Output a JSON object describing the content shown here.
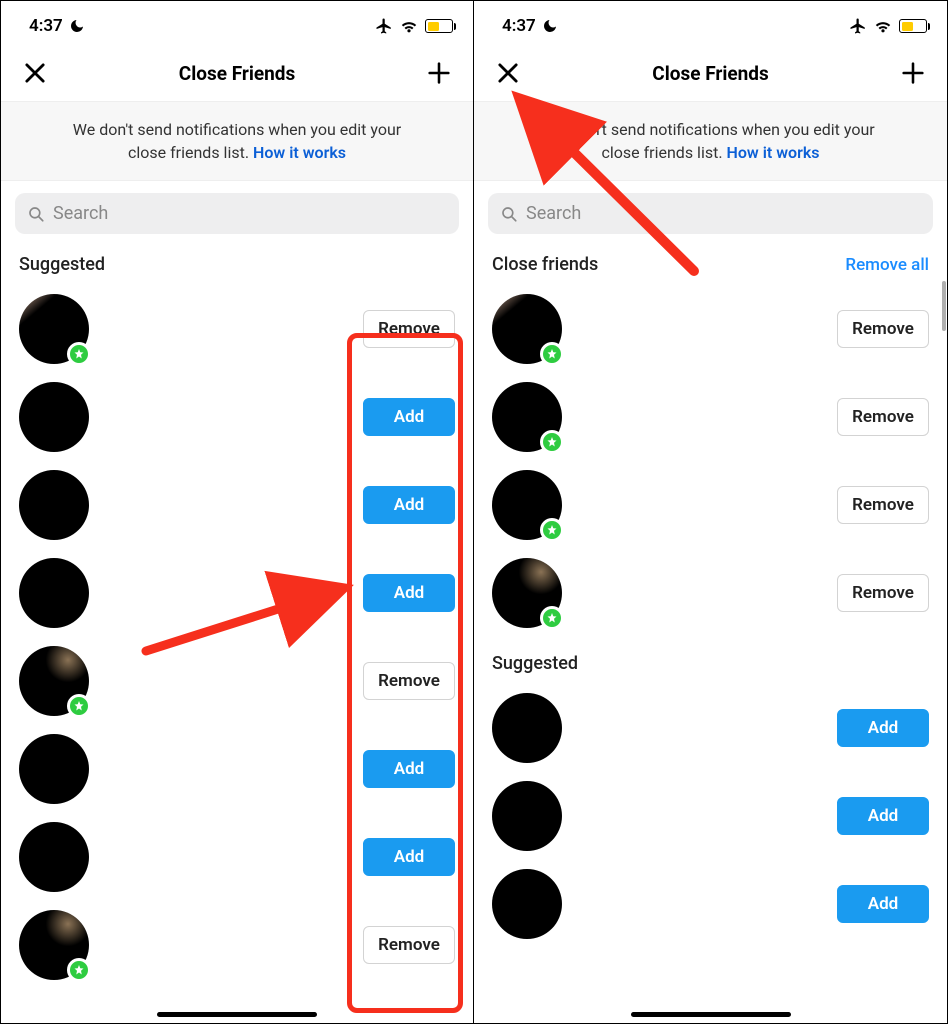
{
  "statusbar": {
    "time": "4:37"
  },
  "header": {
    "title": "Close Friends"
  },
  "banner": {
    "text_a": "We don't send notifications when you edit your",
    "text_b": "close friends list. ",
    "link": "How it works"
  },
  "search": {
    "placeholder": "Search"
  },
  "buttons": {
    "add": "Add",
    "remove": "Remove",
    "remove_all": "Remove all"
  },
  "left": {
    "section_suggested": "Suggested",
    "rows": [
      {
        "star": true,
        "action": "remove",
        "avatarClass": "bg1"
      },
      {
        "star": false,
        "action": "add"
      },
      {
        "star": false,
        "action": "add"
      },
      {
        "star": false,
        "action": "add"
      },
      {
        "star": true,
        "action": "remove",
        "avatarClass": "bg2"
      },
      {
        "star": false,
        "action": "add"
      },
      {
        "star": false,
        "action": "add"
      },
      {
        "star": true,
        "action": "remove",
        "avatarClass": "bg2"
      }
    ]
  },
  "right": {
    "section_close": "Close friends",
    "section_suggested": "Suggested",
    "close_rows": [
      {
        "star": true,
        "avatarClass": "bg1"
      },
      {
        "star": true
      },
      {
        "star": true
      },
      {
        "star": true,
        "avatarClass": "bg2"
      }
    ],
    "suggested_rows": [
      {},
      {},
      {}
    ]
  }
}
